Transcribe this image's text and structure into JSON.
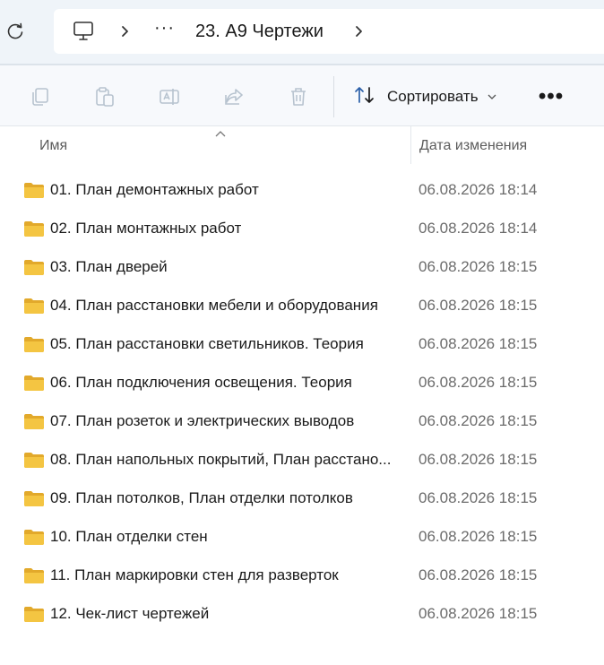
{
  "address_bar": {
    "refresh_icon": "refresh-icon",
    "pc_icon": "monitor-icon",
    "more_label": "···",
    "current_folder": "23. А9 Чертежи"
  },
  "toolbar": {
    "copy_icon": "copy-icon",
    "paste_icon": "paste-icon",
    "rename_icon": "rename-icon",
    "share_icon": "share-icon",
    "delete_icon": "delete-icon",
    "sort_label": "Сортировать",
    "more_label": "•••"
  },
  "columns": {
    "name": "Имя",
    "date": "Дата изменения"
  },
  "files": [
    {
      "name": "01. План демонтажных работ",
      "date": "06.08.2026 18:14"
    },
    {
      "name": "02. План монтажных работ",
      "date": "06.08.2026 18:14"
    },
    {
      "name": "03. План дверей",
      "date": "06.08.2026 18:15"
    },
    {
      "name": "04. План расстановки мебели и оборудования",
      "date": "06.08.2026 18:15"
    },
    {
      "name": "05. План расстановки светильников. Теория",
      "date": "06.08.2026 18:15"
    },
    {
      "name": "06. План подключения освещения. Теория",
      "date": "06.08.2026 18:15"
    },
    {
      "name": "07. План розеток и электрических выводов",
      "date": "06.08.2026 18:15"
    },
    {
      "name": "08. План напольных покрытий, План расстано...",
      "date": "06.08.2026 18:15"
    },
    {
      "name": "09. План потолков, План отделки потолков",
      "date": "06.08.2026 18:15"
    },
    {
      "name": "10. План отделки стен",
      "date": "06.08.2026 18:15"
    },
    {
      "name": "11. План маркировки стен для разверток",
      "date": "06.08.2026 18:15"
    },
    {
      "name": "12. Чек-лист чертежей",
      "date": "06.08.2026 18:15"
    }
  ],
  "colors": {
    "folder": "#f4c542",
    "folder_dark": "#e2a92b",
    "toolbar_icon_disabled": "#b7c3cf",
    "sort_icon": "#2a5fa8"
  }
}
